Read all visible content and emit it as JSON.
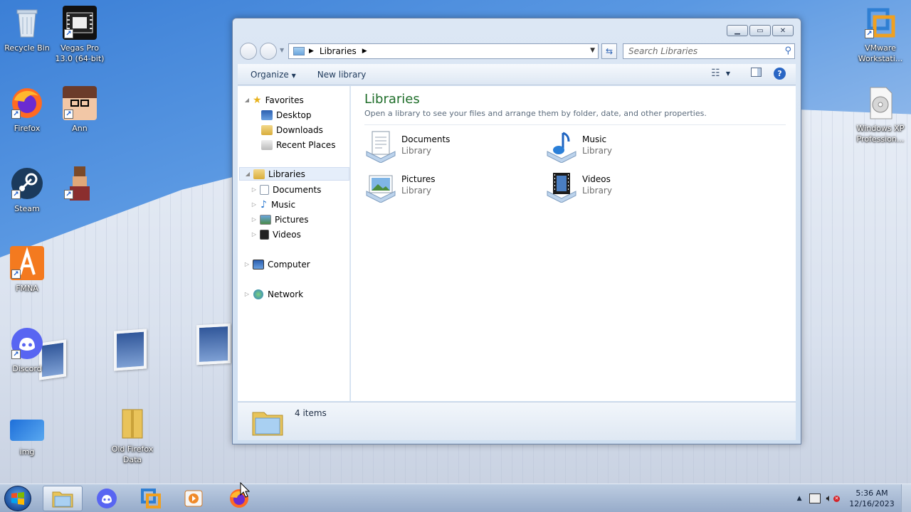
{
  "desktop": {
    "icons": [
      {
        "label": "Recycle Bin"
      },
      {
        "label": "Vegas Pro 13.0 (64-bit)"
      },
      {
        "label": "Firefox"
      },
      {
        "label": "Ann"
      },
      {
        "label": "Steam"
      },
      {
        "label": ""
      },
      {
        "label": "FMNA"
      },
      {
        "label": "Discord"
      },
      {
        "label": "img"
      },
      {
        "label": "Old Firefox Data"
      },
      {
        "label": "VMware Workstati..."
      },
      {
        "label": "Windows XP Profession..."
      }
    ]
  },
  "explorer": {
    "address": {
      "crumb": "Libraries"
    },
    "search": {
      "placeholder": "Search Libraries"
    },
    "command_bar": {
      "organize": "Organize",
      "new_library": "New library"
    },
    "nav_pane": {
      "favorites": "Favorites",
      "favorites_items": [
        "Desktop",
        "Downloads",
        "Recent Places"
      ],
      "libraries": "Libraries",
      "libraries_items": [
        "Documents",
        "Music",
        "Pictures",
        "Videos"
      ],
      "computer": "Computer",
      "network": "Network"
    },
    "content": {
      "title": "Libraries",
      "subtitle": "Open a library to see your files and arrange them by folder, date, and other properties.",
      "libraries": [
        {
          "name": "Documents",
          "kind": "Library"
        },
        {
          "name": "Music",
          "kind": "Library"
        },
        {
          "name": "Pictures",
          "kind": "Library"
        },
        {
          "name": "Videos",
          "kind": "Library"
        }
      ]
    },
    "details": {
      "count": "4 items"
    }
  },
  "taskbar": {
    "time": "5:36 AM",
    "date": "12/16/2023"
  },
  "colors": {
    "accent": "#1f6e2a",
    "taskbar": "#a9bcd6",
    "desktop_sky": "#4a8be0"
  }
}
